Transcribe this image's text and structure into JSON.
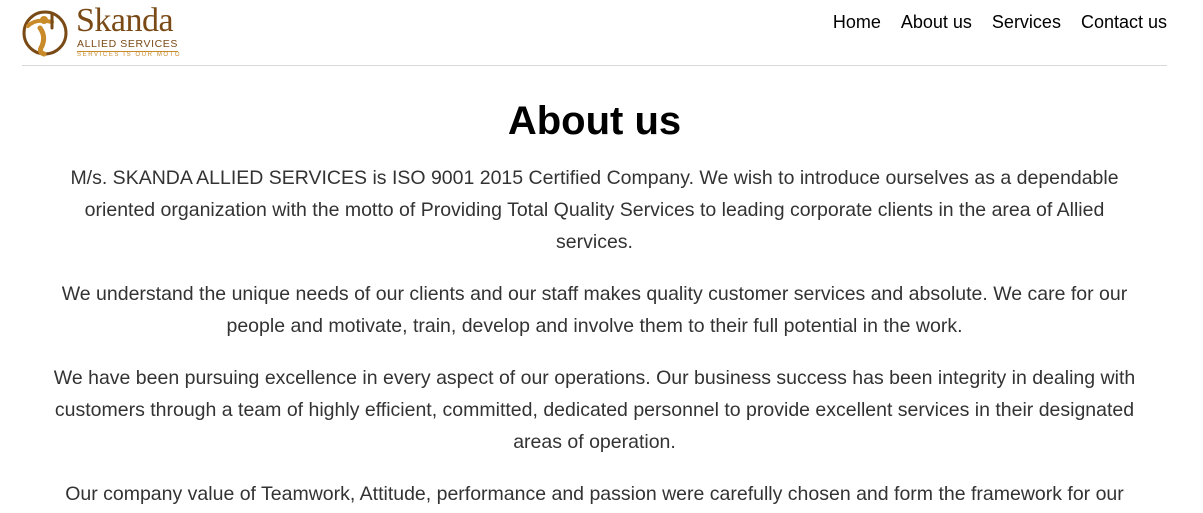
{
  "header": {
    "logo": {
      "name": "Skanda",
      "subtitle": "ALLIED SERVICES",
      "tagline": "SERVICES IS OUR MOTO"
    },
    "nav": [
      {
        "label": "Home"
      },
      {
        "label": "About us"
      },
      {
        "label": "Services"
      },
      {
        "label": "Contact us"
      }
    ]
  },
  "main": {
    "title": "About us",
    "paragraphs": [
      "M/s. SKANDA ALLIED SERVICES is ISO 9001 2015 Certified Company. We wish to introduce ourselves as a dependable oriented organization with the motto of Providing Total Quality Services to leading corporate clients in the area of Allied services.",
      "We understand the unique needs of our clients and our staff makes quality customer services and absolute. We care for our people and motivate, train, develop and involve them to their full potential in the work.",
      "We have been pursuing excellence in every aspect of our operations. Our business success has been integrity in dealing with customers through a team of highly efficient, committed, dedicated personnel to provide excellent services in their designated areas of operation.",
      "Our company value of Teamwork, Attitude, performance and passion were carefully chosen and form the framework for our"
    ]
  },
  "colors": {
    "brand_brown": "#7a4a16",
    "brand_orange": "#c98a2a",
    "body_text": "#333333"
  }
}
